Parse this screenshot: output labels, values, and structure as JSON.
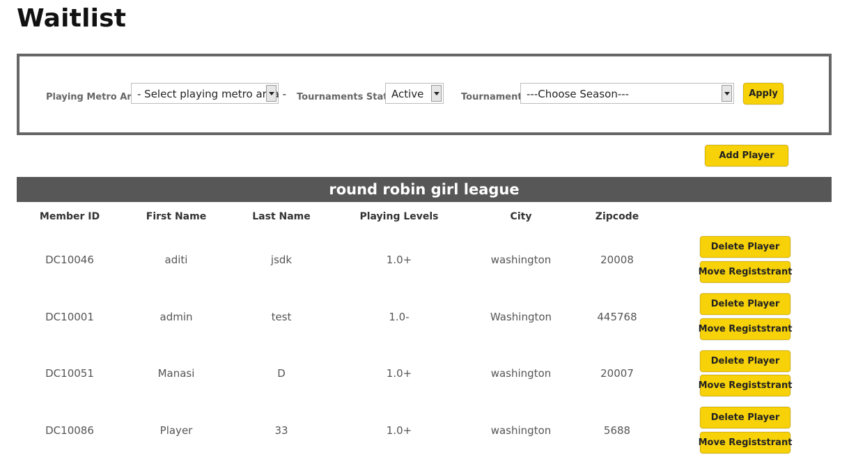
{
  "page": {
    "title": "Waitlist"
  },
  "filters": {
    "metro_label": "Playing Metro Area",
    "metro_value": "- Select playing metro area -",
    "status_label": "Tournaments Status",
    "status_value": "Active",
    "tournaments_label": "Tournaments",
    "tournaments_value": "---Choose Season---",
    "apply_label": "Apply"
  },
  "actions": {
    "add_player_label": "Add Player"
  },
  "league": {
    "name": "round robin girl league"
  },
  "table": {
    "headers": [
      "Member ID",
      "First Name",
      "Last Name",
      "Playing Levels",
      "City",
      "Zipcode"
    ],
    "rows": [
      {
        "member_id": "DC10046",
        "first_name": "aditi",
        "last_name": "jsdk",
        "level": "1.0+",
        "city": "washington",
        "zipcode": "20008"
      },
      {
        "member_id": "DC10001",
        "first_name": "admin",
        "last_name": "test",
        "level": "1.0-",
        "city": "Washington",
        "zipcode": "445768"
      },
      {
        "member_id": "DC10051",
        "first_name": "Manasi",
        "last_name": "D",
        "level": "1.0+",
        "city": "washington",
        "zipcode": "20007"
      },
      {
        "member_id": "DC10086",
        "first_name": "Player",
        "last_name": "33",
        "level": "1.0+",
        "city": "washington",
        "zipcode": "5688"
      }
    ],
    "delete_label": "Delete Player",
    "move_label": "Move Registstrant"
  },
  "colors": {
    "accent": "#f7d209",
    "bar": "#575757",
    "border": "#666666"
  }
}
